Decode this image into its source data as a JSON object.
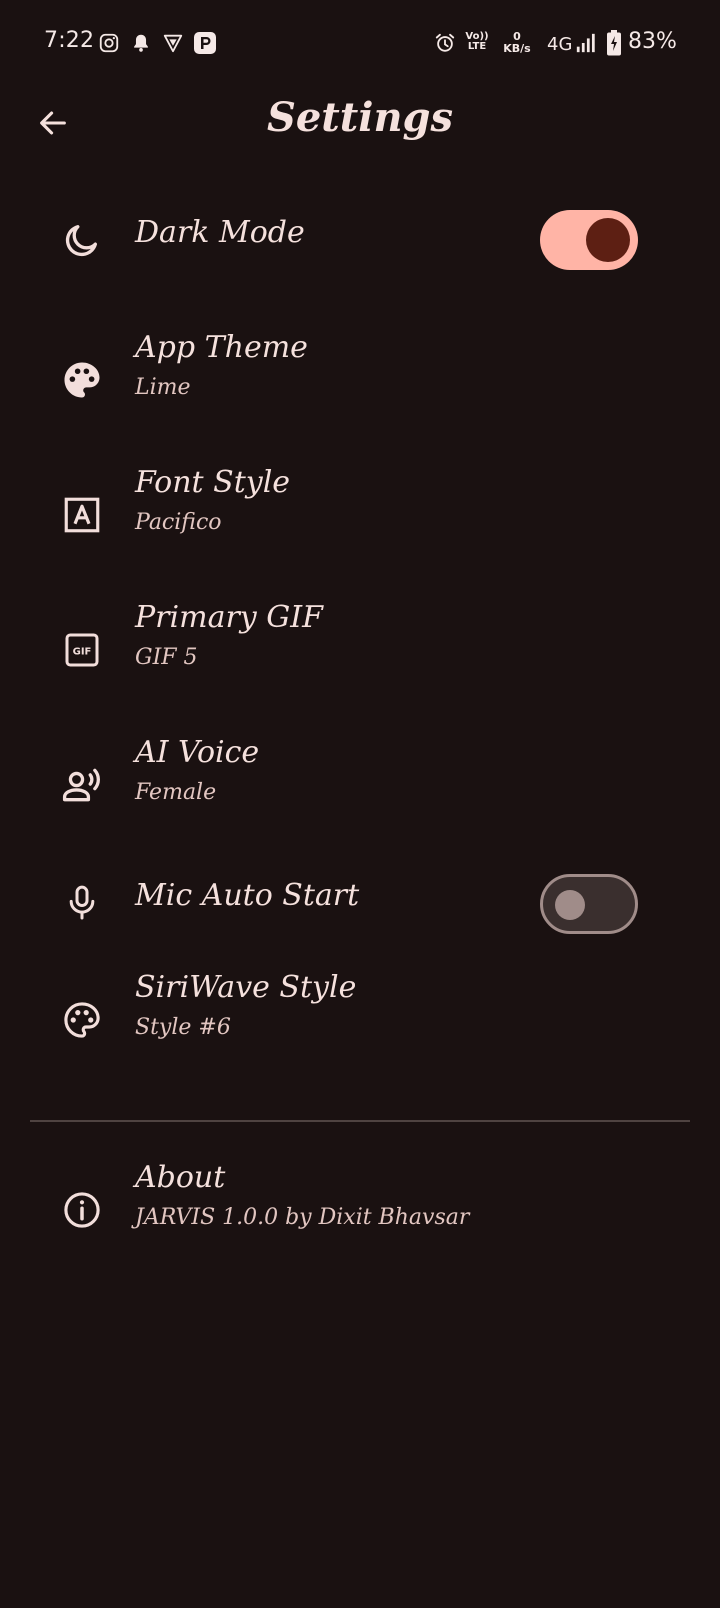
{
  "status_bar": {
    "time": "7:22",
    "volte_top": "Vo))",
    "volte_bottom": "LTE",
    "kbs_value": "0",
    "kbs_unit": "KB/s",
    "network": "4G",
    "battery_percent": "83%",
    "icons": [
      "instagram-icon",
      "notification-bell-icon",
      "vpn-shield-icon",
      "parking-app-icon",
      "alarm-icon",
      "signal-icon",
      "battery-charging-icon"
    ]
  },
  "app_bar": {
    "title": "Settings",
    "back_icon": "arrow-back-icon"
  },
  "settings": {
    "dark_mode": {
      "title": "Dark Mode",
      "icon": "moon-icon",
      "enabled": true
    },
    "app_theme": {
      "title": "App Theme",
      "value": "Lime",
      "icon": "palette-icon"
    },
    "font_style": {
      "title": "Font Style",
      "value": "Pacifico",
      "icon": "font-icon"
    },
    "primary_gif": {
      "title": "Primary GIF",
      "value": "GIF 5",
      "icon": "gif-icon",
      "icon_text": "GIF"
    },
    "ai_voice": {
      "title": "AI Voice",
      "value": "Female",
      "icon": "voice-person-icon"
    },
    "mic_auto_start": {
      "title": "Mic Auto Start",
      "icon": "mic-icon",
      "enabled": false
    },
    "siriwave_style": {
      "title": "SiriWave Style",
      "value": "Style #6",
      "icon": "palette-outline-icon"
    },
    "about": {
      "title": "About",
      "value": "JARVIS 1.0.0 by Dixit Bhavsar",
      "icon": "info-icon"
    }
  },
  "colors": {
    "background": "#1a1111",
    "text": "#f5e1dd",
    "toggle_on_track": "#ffb4a6",
    "toggle_on_knob": "#5d1f13",
    "toggle_off_outline": "#a08c89"
  }
}
